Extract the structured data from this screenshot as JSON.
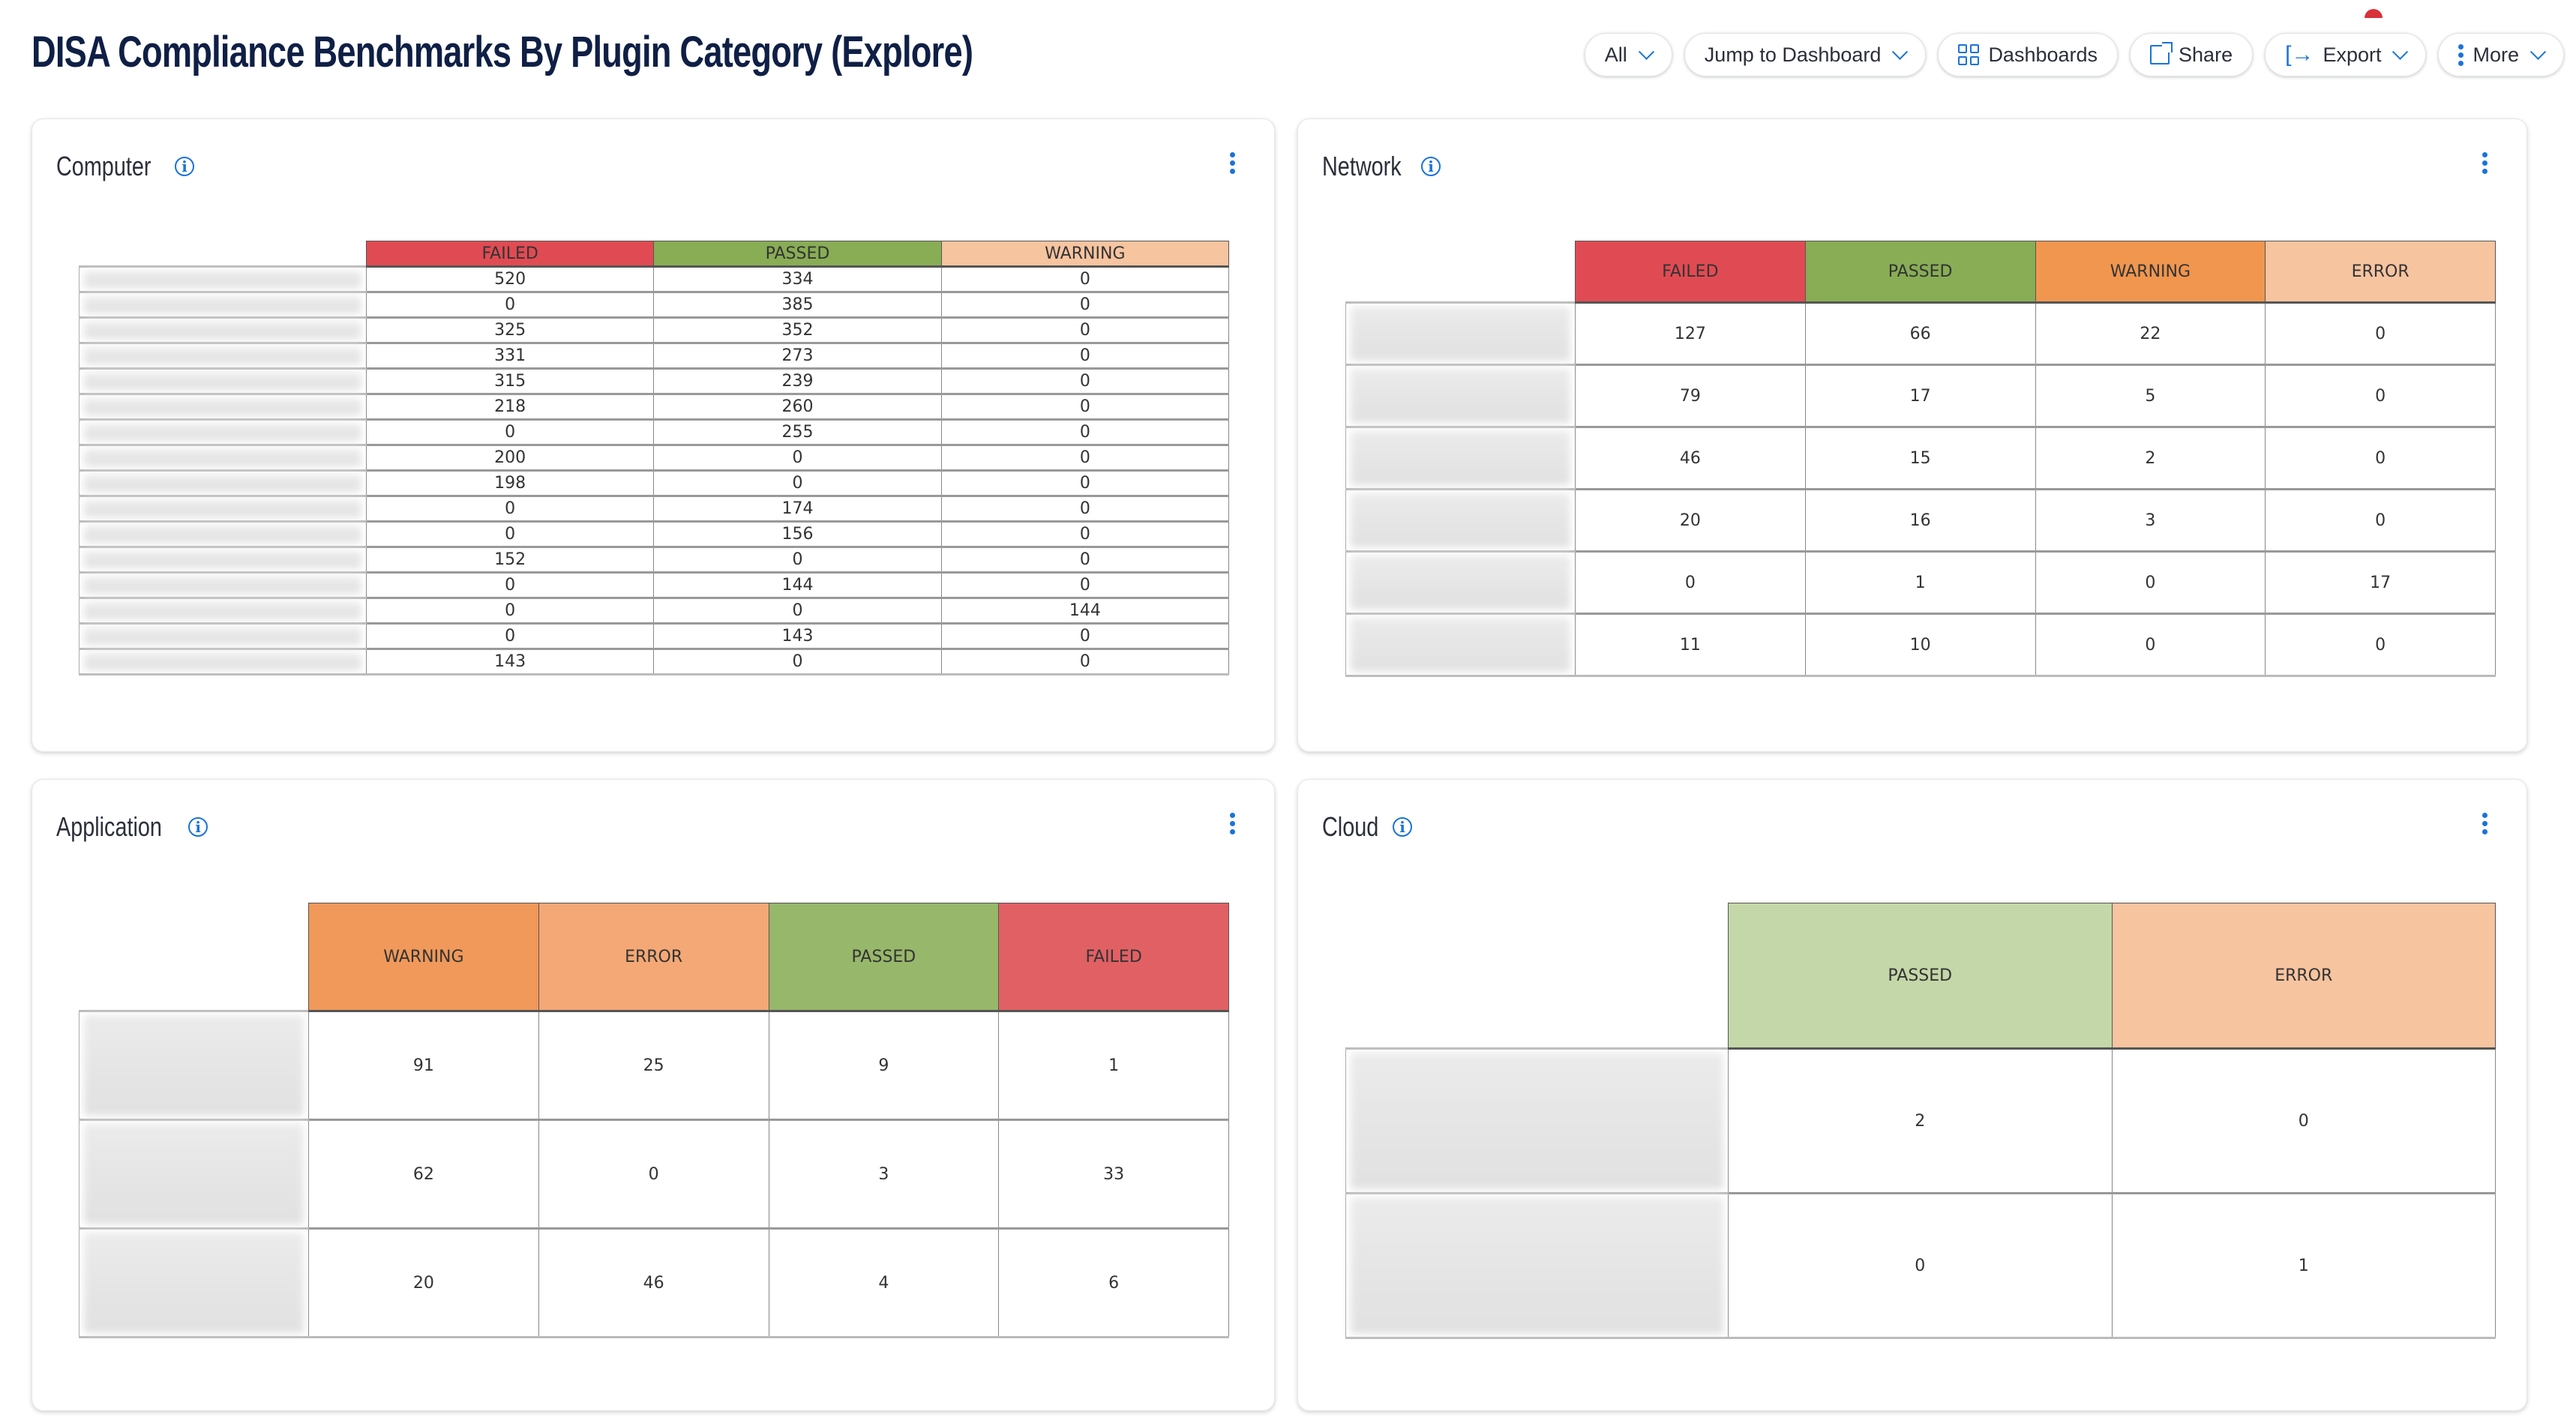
{
  "header": {
    "title": "DISA Compliance Benchmarks By Plugin Category (Explore)",
    "buttons": {
      "filter_label": "All",
      "jump_label": "Jump to Dashboard",
      "dashboards_label": "Dashboards",
      "share_label": "Share",
      "export_label": "Export",
      "more_label": "More"
    }
  },
  "colors": {
    "accent": "#1a73d9",
    "title": "#0f1f45",
    "failed": "#e04b53",
    "failed_light": "#e16064",
    "passed": "#88ad55",
    "passed_mid": "#97b76a",
    "passed_light": "#c4d7a8",
    "warning": "#f0964f",
    "warning_light": "#f7c4a0",
    "error": "#f3a875",
    "error_light": "#f7c4a0"
  },
  "panels": {
    "computer": {
      "title": "Computer",
      "columns": [
        {
          "label": "FAILED",
          "color": "#e04b53"
        },
        {
          "label": "PASSED",
          "color": "#88ad55"
        },
        {
          "label": "WARNING",
          "color": "#f7c4a0"
        }
      ],
      "rows": [
        [
          "520",
          "334",
          "0"
        ],
        [
          "0",
          "385",
          "0"
        ],
        [
          "325",
          "352",
          "0"
        ],
        [
          "331",
          "273",
          "0"
        ],
        [
          "315",
          "239",
          "0"
        ],
        [
          "218",
          "260",
          "0"
        ],
        [
          "0",
          "255",
          "0"
        ],
        [
          "200",
          "0",
          "0"
        ],
        [
          "198",
          "0",
          "0"
        ],
        [
          "0",
          "174",
          "0"
        ],
        [
          "0",
          "156",
          "0"
        ],
        [
          "152",
          "0",
          "0"
        ],
        [
          "0",
          "144",
          "0"
        ],
        [
          "0",
          "0",
          "144"
        ],
        [
          "0",
          "143",
          "0"
        ],
        [
          "143",
          "0",
          "0"
        ]
      ]
    },
    "network": {
      "title": "Network",
      "columns": [
        {
          "label": "FAILED",
          "color": "#e04b53"
        },
        {
          "label": "PASSED",
          "color": "#88ad55"
        },
        {
          "label": "WARNING",
          "color": "#f0964f"
        },
        {
          "label": "ERROR",
          "color": "#f7c4a0"
        }
      ],
      "rows": [
        [
          "127",
          "66",
          "22",
          "0"
        ],
        [
          "79",
          "17",
          "5",
          "0"
        ],
        [
          "46",
          "15",
          "2",
          "0"
        ],
        [
          "20",
          "16",
          "3",
          "0"
        ],
        [
          "0",
          "1",
          "0",
          "17"
        ],
        [
          "11",
          "10",
          "0",
          "0"
        ]
      ]
    },
    "application": {
      "title": "Application",
      "columns": [
        {
          "label": "WARNING",
          "color": "#f0995a"
        },
        {
          "label": "ERROR",
          "color": "#f3a875"
        },
        {
          "label": "PASSED",
          "color": "#97b76a"
        },
        {
          "label": "FAILED",
          "color": "#e16064"
        }
      ],
      "rows": [
        [
          "91",
          "25",
          "9",
          "1"
        ],
        [
          "62",
          "0",
          "3",
          "33"
        ],
        [
          "20",
          "46",
          "4",
          "6"
        ]
      ]
    },
    "cloud": {
      "title": "Cloud",
      "columns": [
        {
          "label": "PASSED",
          "color": "#c4d7a8"
        },
        {
          "label": "ERROR",
          "color": "#f7c4a0"
        }
      ],
      "rows": [
        [
          "2",
          "0"
        ],
        [
          "0",
          "1"
        ]
      ]
    }
  }
}
